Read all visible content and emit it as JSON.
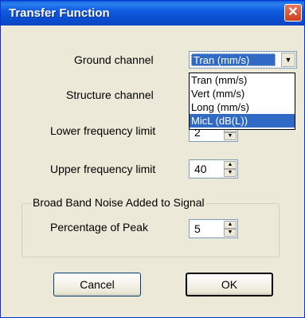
{
  "window": {
    "title": "Transfer Function"
  },
  "labels": {
    "ground": "Ground channel",
    "structure": "Structure channel",
    "lower": "Lower frequency limit",
    "upper": "Upper frequency limit",
    "peak": "Percentage of Peak"
  },
  "ground_combo": {
    "value": "Tran (mm/s)"
  },
  "dropdown_options": [
    "Tran (mm/s)",
    "Vert (mm/s)",
    "Long (mm/s)",
    "MicL (dB(L))"
  ],
  "spinners": {
    "lower": "2",
    "upper": "40",
    "peak": "5"
  },
  "group": {
    "title": "Broad Band Noise Added to Signal"
  },
  "buttons": {
    "cancel": "Cancel",
    "ok": "OK"
  }
}
